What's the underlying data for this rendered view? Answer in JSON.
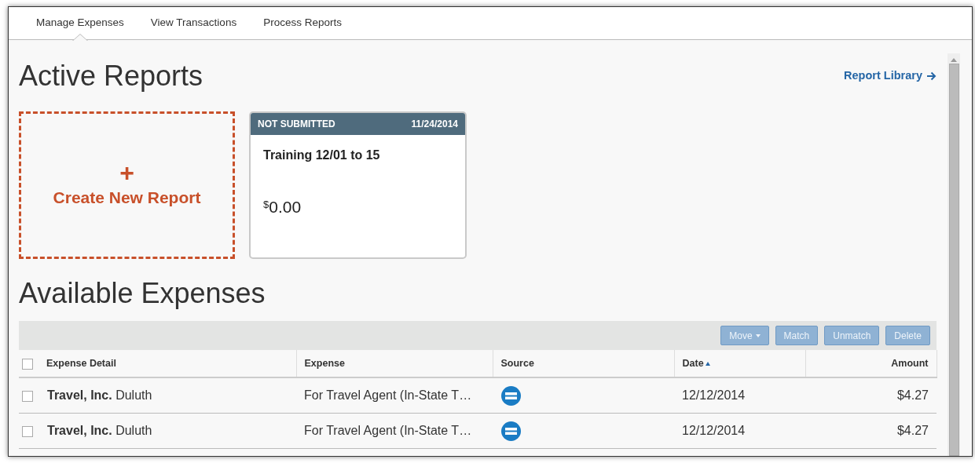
{
  "tabs": [
    {
      "label": "Manage Expenses",
      "selected": true
    },
    {
      "label": "View Transactions",
      "selected": false
    },
    {
      "label": "Process Reports",
      "selected": false
    }
  ],
  "active_reports": {
    "title": "Active Reports",
    "library_link": "Report Library",
    "create_tile": {
      "icon": "+",
      "label": "Create New Report"
    },
    "reports": [
      {
        "status": "NOT SUBMITTED",
        "date": "11/24/2014",
        "name": "Training 12/01 to 15",
        "currency": "$",
        "amount": "0.00"
      }
    ]
  },
  "available_expenses": {
    "title": "Available Expenses",
    "buttons": [
      {
        "label": "Move",
        "dropdown": true,
        "disabled": true
      },
      {
        "label": "Match",
        "dropdown": false,
        "disabled": true
      },
      {
        "label": "Unmatch",
        "dropdown": false,
        "disabled": true
      },
      {
        "label": "Delete",
        "dropdown": false,
        "disabled": true
      }
    ],
    "select_all_checked": false,
    "columns": [
      {
        "label": "Expense Detail",
        "sorted": false
      },
      {
        "label": "Expense",
        "sorted": false
      },
      {
        "label": "Source",
        "sorted": false
      },
      {
        "label": "Date",
        "sorted": true
      },
      {
        "label": "Amount",
        "sorted": false
      }
    ],
    "rows": [
      {
        "checked": false,
        "detail": "**Travel, Inc.** Duluth",
        "expense": "For Travel Agent (In-State T…",
        "date": "12/12/2014",
        "amount": "$4.27"
      },
      {
        "checked": false,
        "detail": "**Travel, Inc.** Duluth",
        "expense": "For Travel Agent (In-State T…",
        "date": "12/12/2014",
        "amount": "$4.27"
      }
    ]
  }
}
